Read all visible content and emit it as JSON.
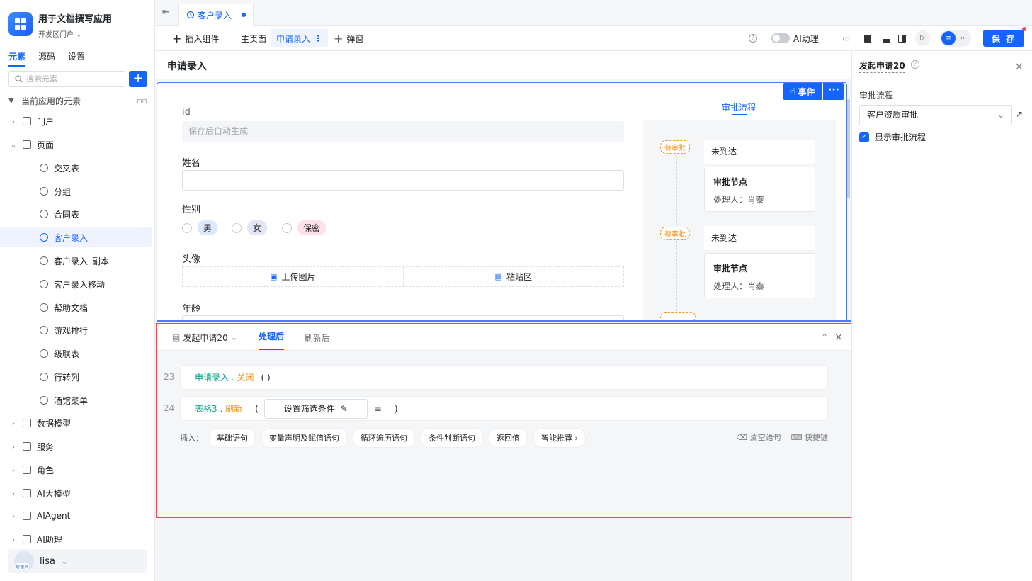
{
  "app": {
    "title": "用于文档撰写应用",
    "subtitle": "开发区门户"
  },
  "sidebar": {
    "tabs": [
      "元素",
      "源码",
      "设置"
    ],
    "search_placeholder": "搜索元素",
    "section_label": "当前应用的元素",
    "items": [
      {
        "label": "门户",
        "icon": "home-icon",
        "chevron": "›"
      },
      {
        "label": "页面",
        "icon": "page-icon",
        "chevron": "⌄"
      },
      {
        "label": "交叉表",
        "icon": "page-item-icon"
      },
      {
        "label": "分组",
        "icon": "page-item-icon"
      },
      {
        "label": "合同表",
        "icon": "page-item-icon"
      },
      {
        "label": "客户录入",
        "icon": "page-item-icon",
        "selected": true
      },
      {
        "label": "客户录入_副本",
        "icon": "page-item-icon"
      },
      {
        "label": "客户录入移动",
        "icon": "page-item-icon"
      },
      {
        "label": "帮助文档",
        "icon": "doc-icon"
      },
      {
        "label": "游戏排行",
        "icon": "page-item-icon"
      },
      {
        "label": "级联表",
        "icon": "page-item-icon"
      },
      {
        "label": "行转列",
        "icon": "page-item-icon"
      },
      {
        "label": "酒馆菜单",
        "icon": "page-item-icon"
      },
      {
        "label": "数据模型",
        "icon": "table-icon",
        "chevron": "›"
      },
      {
        "label": "服务",
        "icon": "service-icon",
        "chevron": "›"
      },
      {
        "label": "角色",
        "icon": "role-icon",
        "chevron": "›"
      },
      {
        "label": "AI大模型",
        "icon": "model-icon",
        "chevron": "›"
      },
      {
        "label": "AIAgent",
        "icon": "robot-icon",
        "chevron": "›"
      },
      {
        "label": "AI助理",
        "icon": "ai-icon",
        "chevron": "›"
      }
    ],
    "user": {
      "name": "lisa",
      "badge": "管理员"
    }
  },
  "tab": {
    "label": "客户录入"
  },
  "toolbar": {
    "insert": "插入组件",
    "home": "主页面",
    "active_page": "申请录入",
    "popup": "弹窗",
    "ai_assistant": "AI助理",
    "save": "保 存"
  },
  "page": {
    "title": "申请录入"
  },
  "form": {
    "id_label": "id",
    "id_placeholder": "保存后自动生成",
    "name_label": "姓名",
    "gender_label": "性别",
    "gender_options": [
      {
        "label": "男",
        "color": "#dbe8ff"
      },
      {
        "label": "女",
        "color": "#e3e6f5"
      },
      {
        "label": "保密",
        "color": "#fde0ea"
      }
    ],
    "avatar_label": "头像",
    "upload_label": "上传图片",
    "paste_label": "粘贴区",
    "age_label": "年龄",
    "event_btn": "事件"
  },
  "flow": {
    "tab": "审批流程",
    "steps": [
      {
        "status": "待审批",
        "state": "未到达",
        "title": "审批节点",
        "handler": "处理人：肖泰"
      },
      {
        "status": "待审批",
        "state": "未到达",
        "title": "审批节点",
        "handler": "处理人：肖泰"
      }
    ]
  },
  "bottom": {
    "tab_action": "发起申请20",
    "tab_after": "处理后",
    "tab_refresh": "刷新后",
    "lines": [
      {
        "num": "23",
        "obj": "申请录入",
        "method": "关闭",
        "args": "( )"
      },
      {
        "num": "24",
        "obj": "表格3",
        "method": "刷新",
        "filter": "设置筛选条件"
      }
    ],
    "insert_label": "插入：",
    "chips": [
      "基础语句",
      "变量声明及赋值语句",
      "循环遍历语句",
      "条件判断语句",
      "返回值",
      "智能推荐"
    ],
    "clear": "清空语句",
    "shortcut": "快捷键"
  },
  "right_panel": {
    "title": "发起申请20",
    "flow_label": "审批流程",
    "flow_value": "客户资质审批",
    "show_flow": "显示审批流程"
  },
  "colors": {
    "accent": "#1664ff",
    "highlight": "#f54a45",
    "teal": "#0aa58a",
    "orange": "#f7931e"
  }
}
